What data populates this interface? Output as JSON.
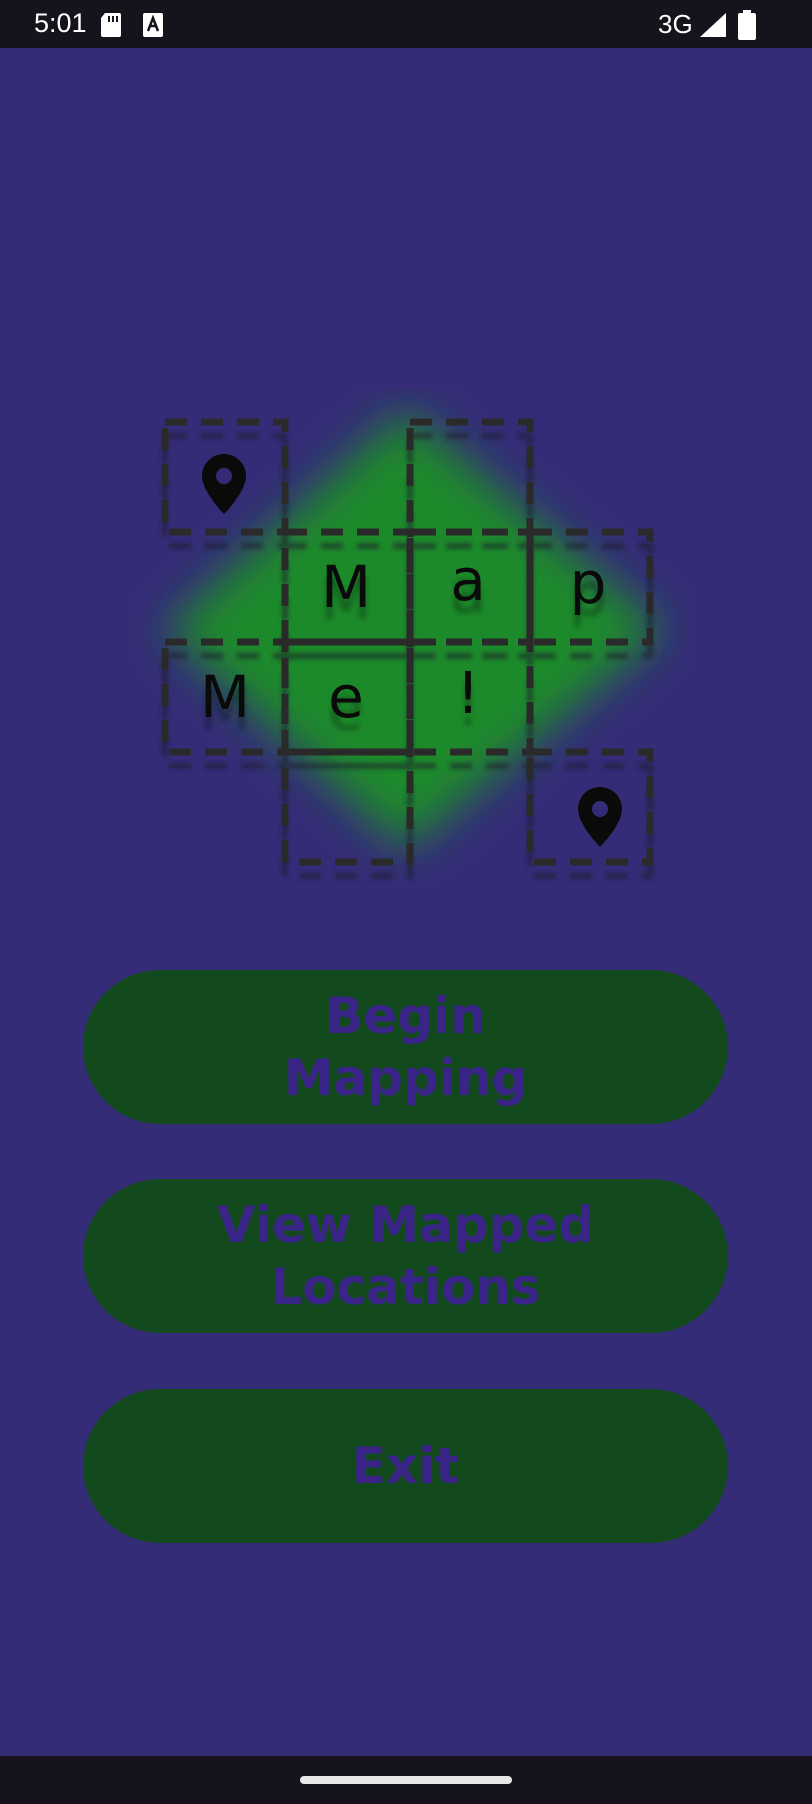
{
  "status_bar": {
    "time": "5:01",
    "network": "3G",
    "icons": [
      "sd-card-icon",
      "font-a-icon",
      "signal-icon",
      "battery-icon"
    ]
  },
  "logo": {
    "letters": [
      "M",
      "a",
      "p",
      "M",
      "e",
      "!"
    ],
    "icons": [
      "location-pin-icon",
      "location-pin-icon"
    ]
  },
  "buttons": {
    "begin": "Begin Mapping",
    "view": "View Mapped Locations",
    "exit": "Exit"
  },
  "colors": {
    "background": "#352c78",
    "button_fill": "#124a1e",
    "button_text": "#3a2488",
    "logo_glow": "#1a8a2a",
    "system_bars": "#16131c"
  }
}
